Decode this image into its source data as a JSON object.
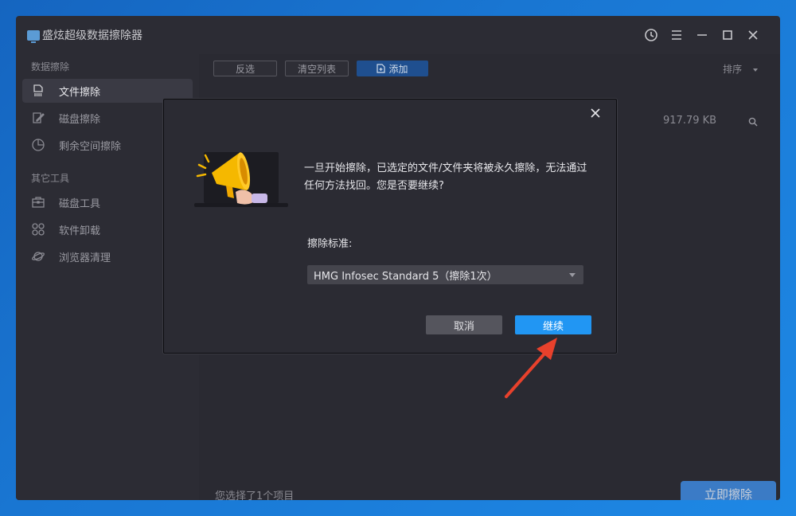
{
  "window": {
    "title": "盛炫超级数据擦除器"
  },
  "sidebar": {
    "sections": [
      {
        "title": "数据擦除"
      },
      {
        "title": "其它工具"
      }
    ],
    "items": [
      {
        "label": "文件擦除",
        "icon": "file-shred-icon",
        "active": true
      },
      {
        "label": "磁盘擦除",
        "icon": "disk-edit-icon"
      },
      {
        "label": "剩余空间擦除",
        "icon": "pie-chart-icon"
      },
      {
        "label": "磁盘工具",
        "icon": "toolbox-icon"
      },
      {
        "label": "软件卸载",
        "icon": "apps-grid-icon"
      },
      {
        "label": "浏览器清理",
        "icon": "planet-icon"
      }
    ]
  },
  "toolbar": {
    "invert_label": "反选",
    "clear_label": "清空列表",
    "add_label": "添加",
    "sort_label": "排序"
  },
  "file": {
    "size": "917.79 KB"
  },
  "status": {
    "text": "您选择了1个项目"
  },
  "wipe_button": {
    "label": "立即擦除"
  },
  "modal": {
    "message": "一旦开始擦除，已选定的文件/文件夹将被永久擦除，无法通过任何方法找回。您是否要继续?",
    "standard_label": "擦除标准:",
    "standard_value": "HMG Infosec Standard 5（擦除1次）",
    "cancel_label": "取消",
    "continue_label": "继续"
  },
  "colors": {
    "accent": "#2196f3",
    "annotation_arrow": "#e8412c"
  }
}
